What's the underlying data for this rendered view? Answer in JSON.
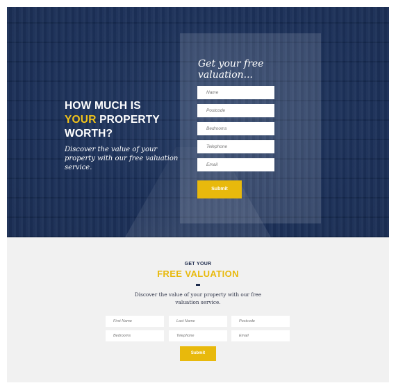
{
  "hero": {
    "title_line1": "HOW MUCH IS",
    "title_accent": "YOUR",
    "title_line2_rest": " PROPERTY",
    "title_line3": "WORTH?",
    "subtitle": "Discover the value of your property with our free valuation service."
  },
  "hero_form": {
    "title": "Get your free valuation...",
    "fields": {
      "name": "Name",
      "postcode": "Postcode",
      "bedrooms": "Bedrooms",
      "telephone": "Telephone",
      "email": "Email"
    },
    "submit_label": "Submit"
  },
  "lower": {
    "heading_small": "GET YOUR",
    "heading_big": "FREE VALUATION",
    "description": "Discover the value of your property with our free valuation service.",
    "fields": {
      "first_name": "First Name",
      "last_name": "Last Name",
      "postcode": "Postcode",
      "bedrooms": "Bedrooms",
      "telephone": "Telephone",
      "email": "Email"
    },
    "submit_label": "Submit"
  },
  "colors": {
    "navy": "#1d2b4c",
    "accent_yellow": "#e8b90c",
    "light_gray": "#f1f1f1"
  }
}
